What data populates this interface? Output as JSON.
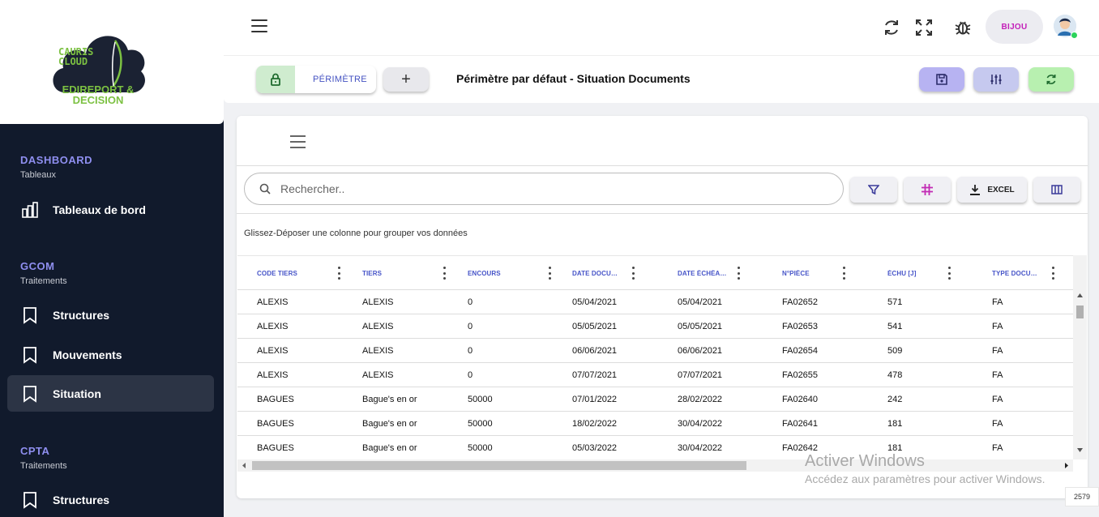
{
  "logo": {
    "line1": "CAURIS",
    "line2": "CLOUD",
    "line3": "EDIREPORT &",
    "line4": "DECISION"
  },
  "sidebar": {
    "sections": [
      {
        "title": "DASHBOARD",
        "subtitle": "Tableaux",
        "items": [
          {
            "label": "Tableaux de bord",
            "icon": "bar-chart-icon"
          }
        ]
      },
      {
        "title": "GCOM",
        "subtitle": "Traitements",
        "items": [
          {
            "label": "Structures",
            "icon": "bookmark-icon"
          },
          {
            "label": "Mouvements",
            "icon": "bookmark-icon"
          },
          {
            "label": "Situation",
            "icon": "bookmark-icon",
            "active": true
          }
        ]
      },
      {
        "title": "CPTA",
        "subtitle": "Traitements",
        "items": [
          {
            "label": "Structures",
            "icon": "bookmark-icon"
          }
        ]
      }
    ]
  },
  "topbar": {
    "user": "BIJOU"
  },
  "subbar": {
    "perimeter_label": "PÉRIMÈTRE",
    "add_label": "+",
    "title": "Périmètre par défaut - Situation Documents"
  },
  "colors": {
    "sidebar_bg": "#111a2c",
    "accent": "#4654c8",
    "save_btn": "#b7b3f2",
    "settings_btn": "#c6c9ef",
    "refresh_btn": "#b8f0b0",
    "lock_bg": "#cfeccf"
  },
  "toolbar": {
    "search_placeholder": "Rechercher..",
    "excel_label": "EXCEL"
  },
  "group_hint": "Glissez-Déposer une colonne pour grouper vos données",
  "table": {
    "columns": [
      "CODE TIERS",
      "TIERS",
      "ENCOURS",
      "DATE DOCUMENT",
      "DATE ÉCHÉANCE",
      "N°PIÈCE",
      "ÉCHU [J]",
      "TYPE DOCUMENT"
    ],
    "rows": [
      [
        "ALEXIS",
        "ALEXIS",
        "0",
        "05/04/2021",
        "05/04/2021",
        "FA02652",
        "571",
        "FA"
      ],
      [
        "ALEXIS",
        "ALEXIS",
        "0",
        "05/05/2021",
        "05/05/2021",
        "FA02653",
        "541",
        "FA"
      ],
      [
        "ALEXIS",
        "ALEXIS",
        "0",
        "06/06/2021",
        "06/06/2021",
        "FA02654",
        "509",
        "FA"
      ],
      [
        "ALEXIS",
        "ALEXIS",
        "0",
        "07/07/2021",
        "07/07/2021",
        "FA02655",
        "478",
        "FA"
      ],
      [
        "BAGUES",
        "Bague's en or",
        "50000",
        "07/01/2022",
        "28/02/2022",
        "FA02640",
        "242",
        "FA"
      ],
      [
        "BAGUES",
        "Bague's en or",
        "50000",
        "18/02/2022",
        "30/04/2022",
        "FA02641",
        "181",
        "FA"
      ],
      [
        "BAGUES",
        "Bague's en or",
        "50000",
        "05/03/2022",
        "30/04/2022",
        "FA02642",
        "181",
        "FA"
      ]
    ]
  },
  "watermark": {
    "title": "Activer Windows",
    "subtitle": "Accédez aux paramètres pour activer Windows."
  },
  "badge": "2579"
}
